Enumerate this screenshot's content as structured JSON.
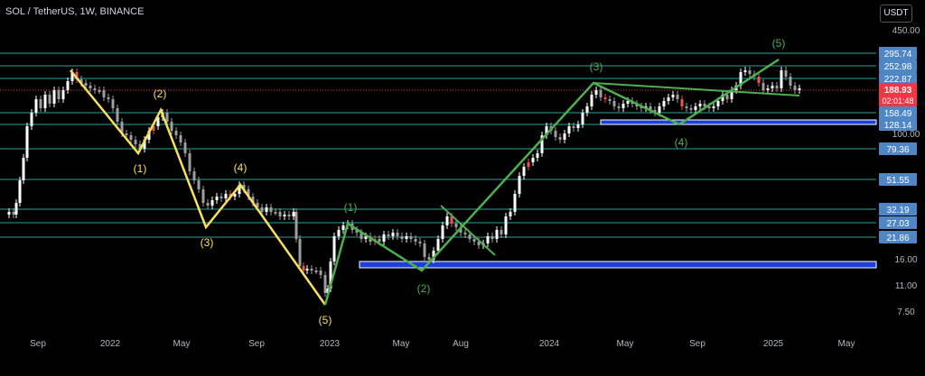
{
  "header": {
    "symbol_title": "SOL / TetherUS, 1W, BINANCE",
    "currency_button": "USDT"
  },
  "colors": {
    "background": "#000000",
    "candle_up": "#ffffff",
    "candle_down": "#9e9e9e",
    "candle_red": "#ef5350",
    "yellow_wave": "#f6e05e",
    "green_wave": "#4caf50",
    "level_line": "#26a69a",
    "zone_fill": "#1e3fd6",
    "current_price_bg": "#f23645"
  },
  "chart_data": {
    "type": "candlestick",
    "title": "",
    "y_scale": "log",
    "y_axis_ticks": [
      "450.00",
      "100.00",
      "16.00",
      "11.00",
      "7.50"
    ],
    "x_axis_ticks": [
      "Sep",
      "2022",
      "May",
      "Sep",
      "2023",
      "May",
      "Aug",
      "2024",
      "May",
      "Sep",
      "2025",
      "May"
    ],
    "horizontal_levels": [
      "295.74",
      "252.98",
      "222.87",
      "158.49",
      "128.14",
      "79.36",
      "51.55",
      "32.19",
      "27.03",
      "21.86"
    ],
    "current_price": {
      "value": "188.93",
      "countdown": "02:01:48"
    },
    "yellow_wave_labels": [
      "(2)",
      "(1)",
      "(4)",
      "(3)",
      "(5)"
    ],
    "green_wave_labels": [
      "(1)",
      "(2)",
      "(3)",
      "(4)",
      "(5)"
    ],
    "support_zones": [
      "low zone (2023)",
      "high zone (2024-2025)"
    ]
  }
}
